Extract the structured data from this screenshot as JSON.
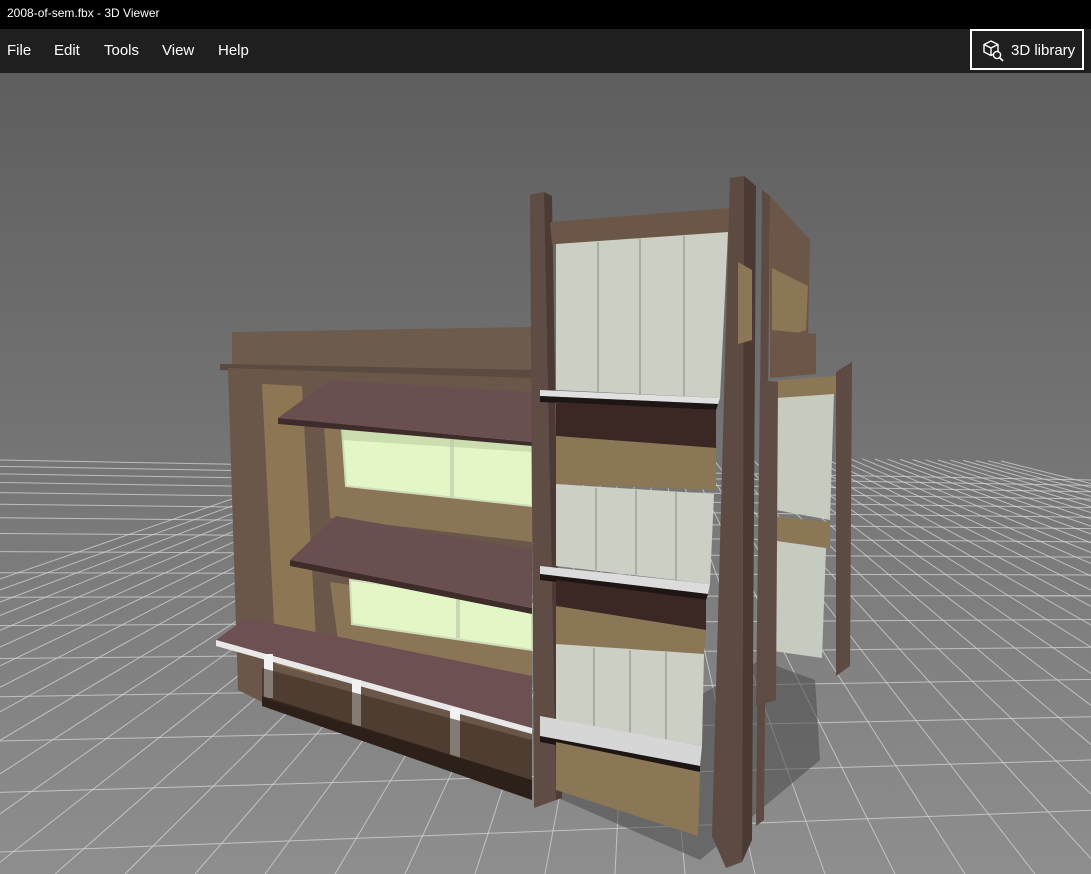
{
  "window": {
    "title": "2008-of-sem.fbx - 3D Viewer"
  },
  "menu": {
    "items": [
      {
        "label": "File"
      },
      {
        "label": "Edit"
      },
      {
        "label": "Tools"
      },
      {
        "label": "View"
      },
      {
        "label": "Help"
      }
    ]
  },
  "library_button": {
    "label": "3D library",
    "icon": "3d-library-icon"
  },
  "scene": {
    "model": "building",
    "colors": {
      "background_top": "#5f5f5f",
      "background_bottom": "#8c8c8c",
      "grid": "#d4d4d4",
      "wall_brown": "#6e5a4c",
      "panel_tan": "#8a7554",
      "window_glass": "#e2f7c4",
      "facade_panel": "#c9cdc3",
      "awning": "#6a4e4f",
      "dark_band": "#3a2824"
    }
  }
}
